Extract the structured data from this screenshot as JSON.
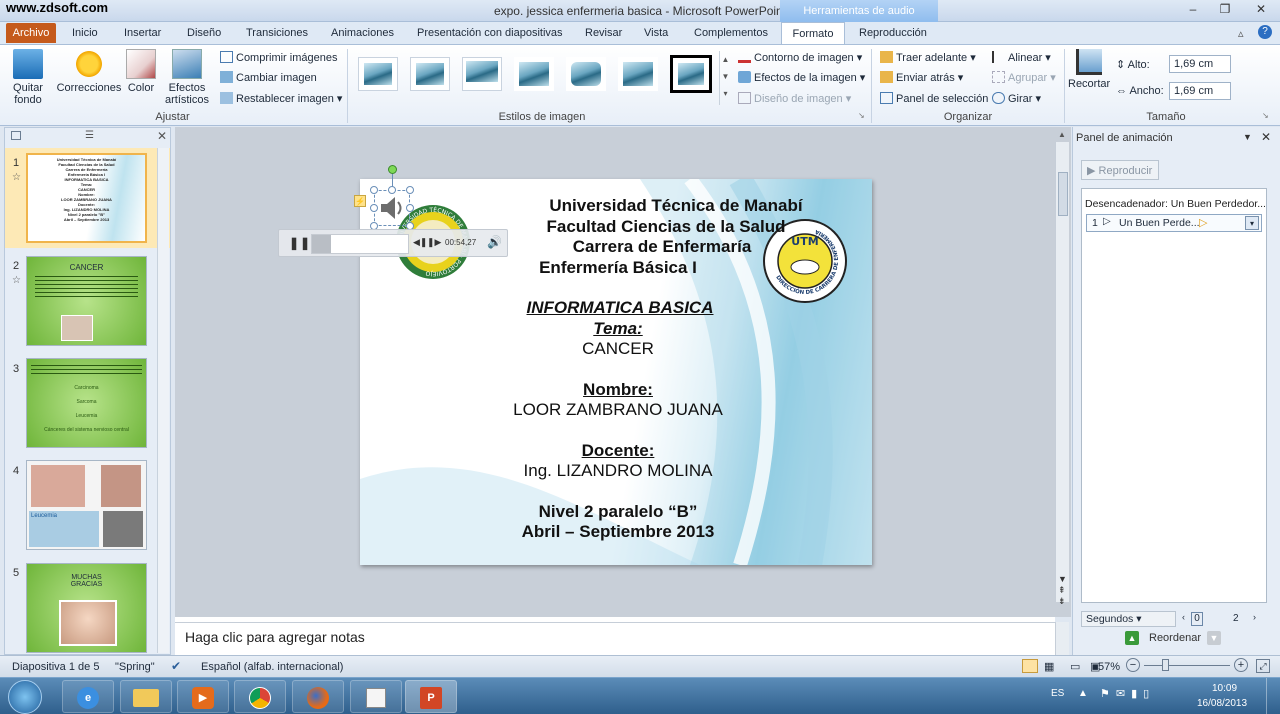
{
  "window": {
    "watermark": "www.zdsoft.com",
    "title": "expo. jessica enfermeria basica  -  Microsoft PowerPoint",
    "contextual_header": "Herramientas de audio",
    "minimize": "–",
    "maximize": "❐",
    "close": "✕"
  },
  "tabs": [
    "Archivo",
    "Inicio",
    "Insertar",
    "Diseño",
    "Transiciones",
    "Animaciones",
    "Presentación con diapositivas",
    "Revisar",
    "Vista",
    "Complementos",
    "Formato",
    "Reproducción"
  ],
  "ribbon": {
    "ajustar": {
      "label": "Ajustar",
      "quitar_fondo": "Quitar fondo",
      "correcciones": "Correcciones",
      "color": "Color",
      "efectos_artisticos": "Efectos artísticos",
      "comprimir": "Comprimir imágenes",
      "cambiar": "Cambiar imagen",
      "restablecer": "Restablecer imagen"
    },
    "estilos": {
      "label": "Estilos de imagen"
    },
    "estilos_right": {
      "contorno": "Contorno de imagen",
      "efectos": "Efectos de la imagen",
      "diseno": "Diseño de imagen"
    },
    "organizar": {
      "label": "Organizar",
      "traer": "Traer adelante",
      "enviar": "Enviar atrás",
      "panel": "Panel de selección",
      "alinear": "Alinear",
      "agrupar": "Agrupar",
      "girar": "Girar"
    },
    "tamano": {
      "label": "Tamaño",
      "recortar": "Recortar",
      "alto_label": "Alto:",
      "alto": "1,69 cm",
      "ancho_label": "Ancho:",
      "ancho": "1,69 cm"
    }
  },
  "slides_panel": {
    "numbers": [
      "1",
      "2",
      "3",
      "4",
      "5"
    ],
    "t2_title": "CANCER",
    "t3_lines": [
      "Carcinoma",
      "Sarcoma",
      "Leucemia",
      "Cánceres del sistema nervioso central"
    ],
    "t4_label": "Leucemia",
    "t5_text": "MUCHAS GRACIAS",
    "t1_lines": [
      "Universidad Técnica de Manabí",
      "Facultad Ciencias de la Salud",
      "Carrera de Enfermería",
      "Enfermería Básica I",
      "INFORMATICA BASICA",
      "Tema:",
      "CANCER",
      "Nombre:",
      "LOOR ZAMBRANO JUANA",
      "Docente:",
      "Ing. LIZANDRO MOLINA",
      "Nivel 2 paralelo \"B\"",
      "Abril – Septiembre 2013"
    ]
  },
  "slide": {
    "l1": "Universidad Técnica de Manabí",
    "l2": "Facultad Ciencias de la Salud",
    "l3": "Carrera de Enfermaría",
    "l4": "Enfermería Básica I",
    "l5": "INFORMATICA BASICA",
    "l6": "Tema:",
    "l7": "CANCER",
    "l8": "Nombre:",
    "l9": "LOOR ZAMBRANO  JUANA",
    "l10": "Docente:",
    "l11": "Ing. LIZANDRO  MOLINA",
    "l12": "Nivel 2 paralelo “B”",
    "l13": "Abril – Septiembre 2013",
    "logo_utm": "UTM",
    "logo_utm_ring": "DIRECCIÓN DE CARRERA DE ENFERMERÍA",
    "logo_left_ring": "UNIVERSIDAD TÉCNICA DE MANABÍ · PORTOVIEJO"
  },
  "audio": {
    "time": "00:54,27",
    "progress": 0.2
  },
  "notes_placeholder": "Haga clic para agregar notas",
  "anim_pane": {
    "title": "Panel de animación",
    "play": "Reproducir",
    "trigger": "Desencadenador: Un Buen Perdedor...",
    "item_num": "1",
    "item_label": "Un Buen Perde...",
    "segundos": "Segundos",
    "scale_0": "0",
    "scale_2": "2",
    "reordenar": "Reordenar"
  },
  "status": {
    "slide": "Diapositiva 1 de 5",
    "theme": "\"Spring\"",
    "lang": "Español (alfab. internacional)",
    "zoom": "57%"
  },
  "taskbar": {
    "lang": "ES",
    "time": "10:09",
    "date": "16/08/2013"
  }
}
